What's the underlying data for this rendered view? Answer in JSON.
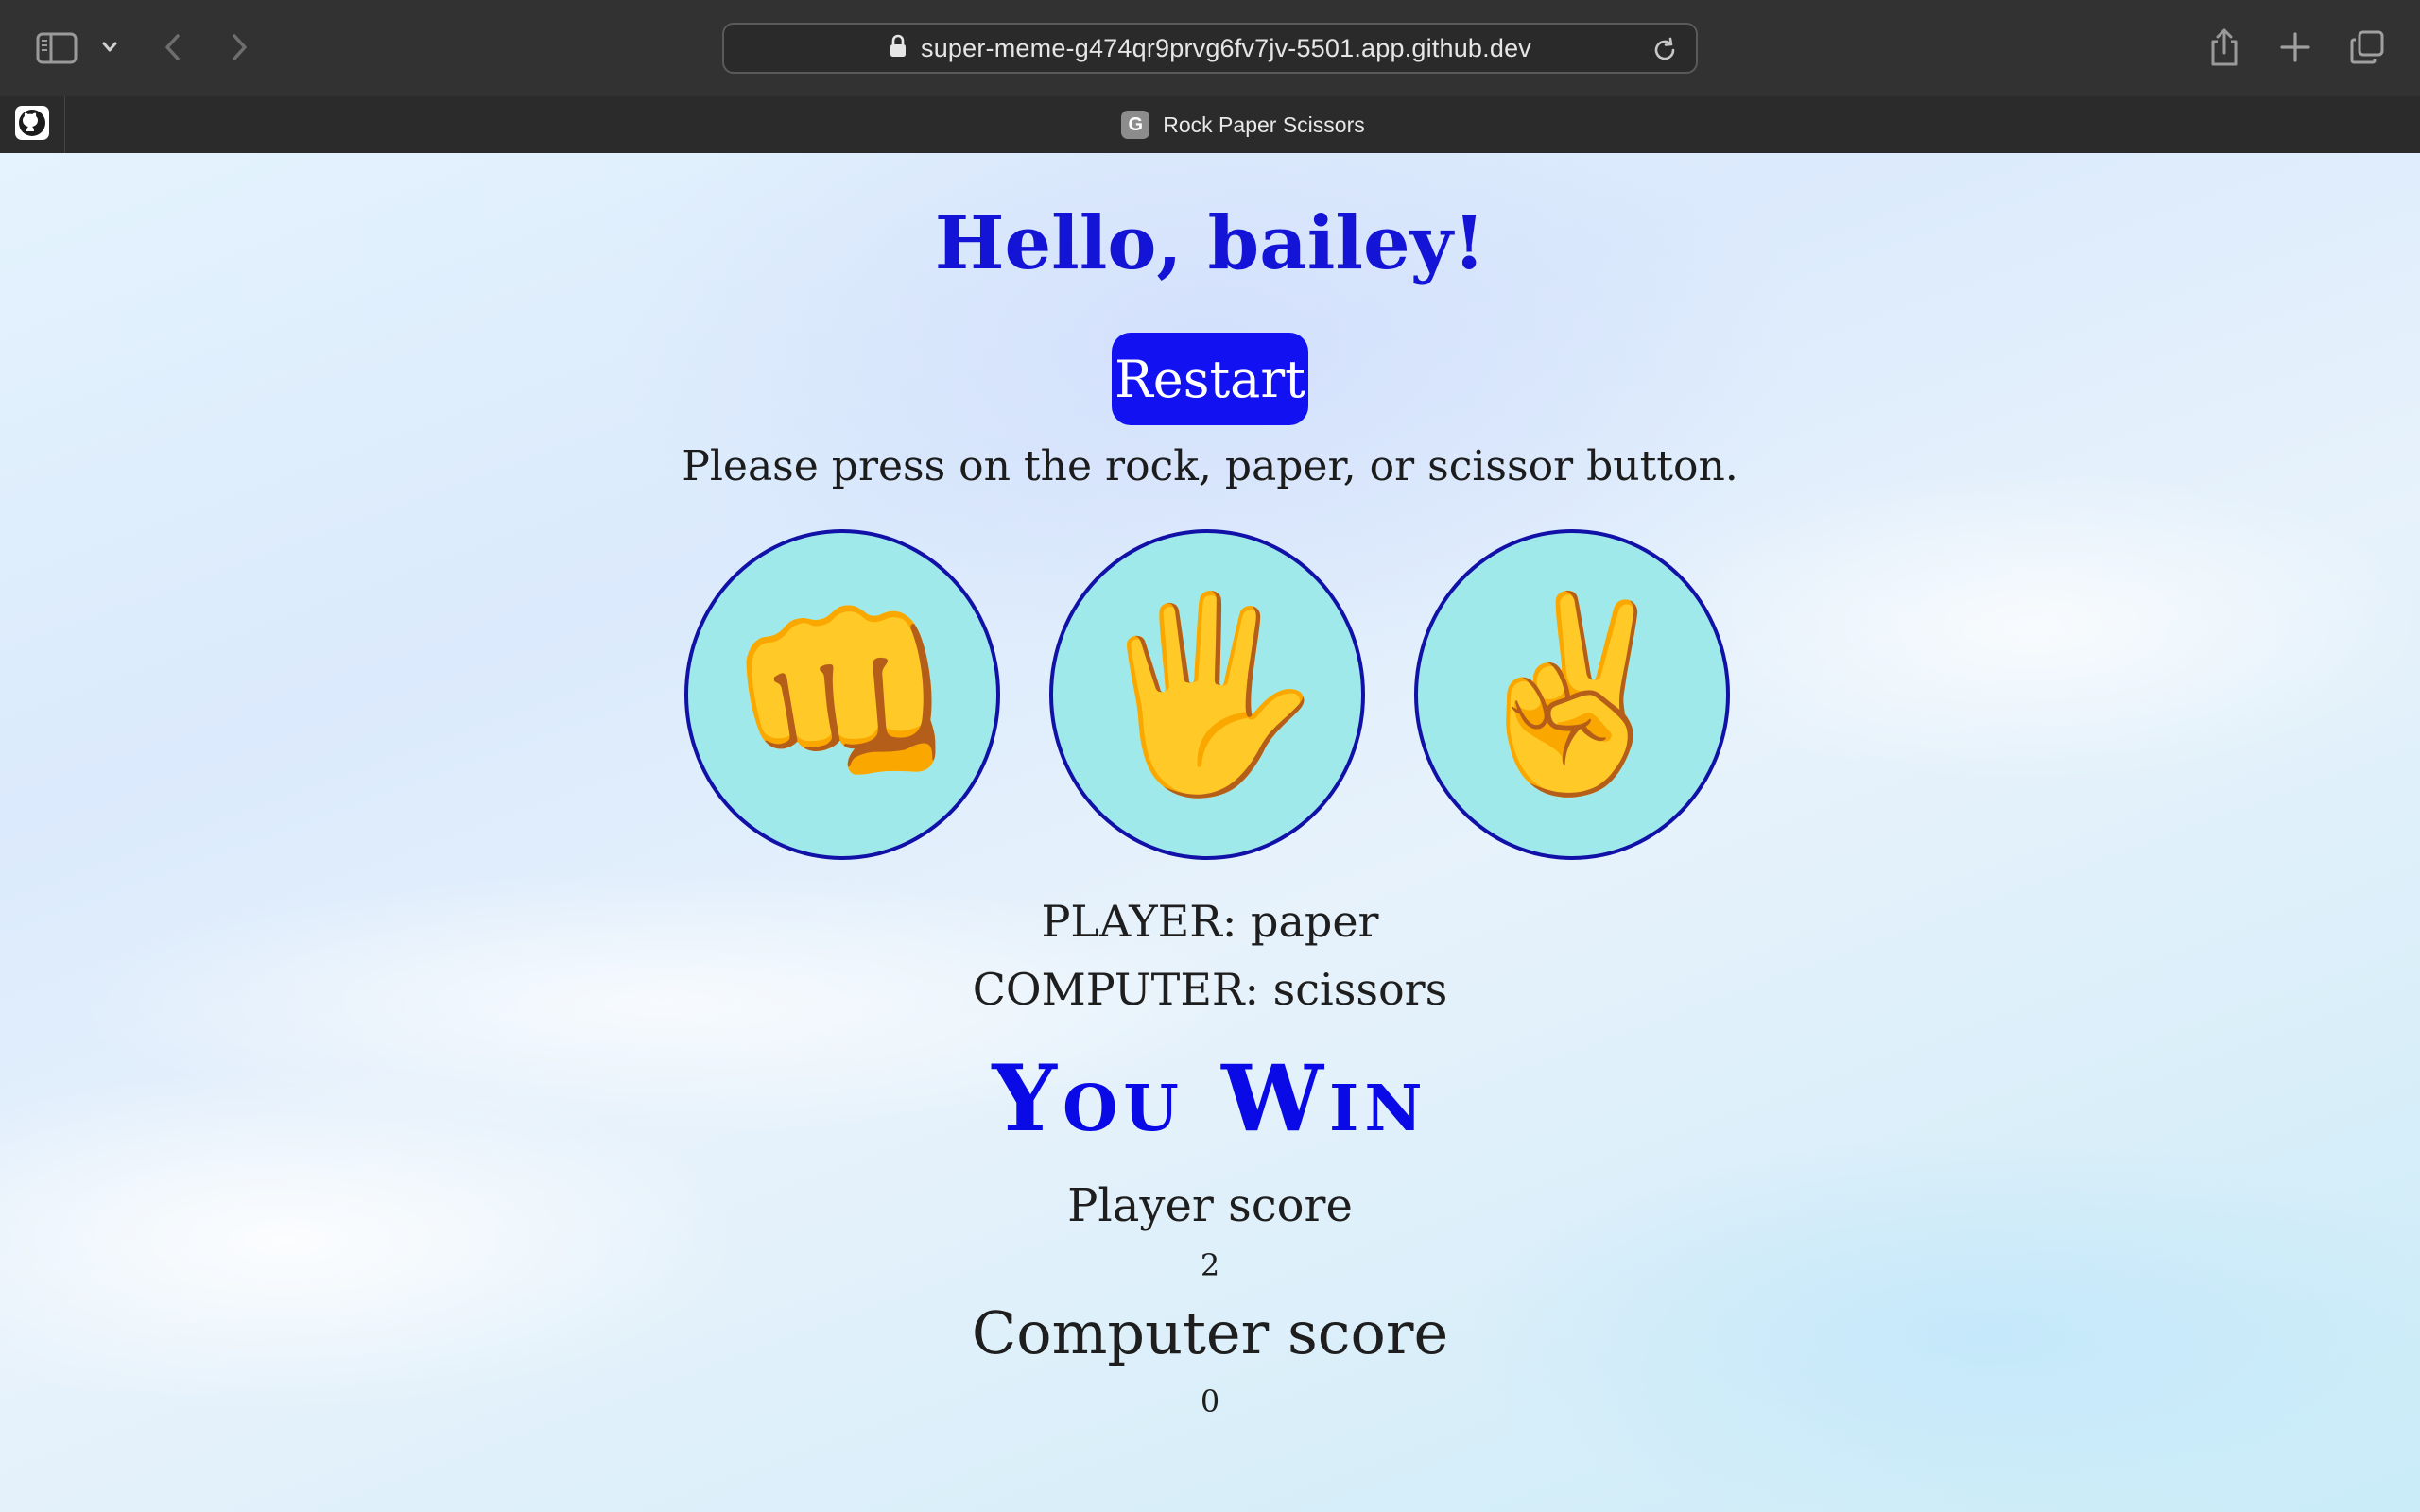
{
  "browser": {
    "url": "super-meme-g474qr9prvg6fv7jv-5501.app.github.dev",
    "tab_title": "Rock Paper Scissors",
    "favicon_letter": "G",
    "icons": [
      "sidebar-icon",
      "chevron-down-icon",
      "back-icon",
      "forward-icon",
      "lock-icon",
      "reload-icon",
      "share-icon",
      "new-tab-icon",
      "tab-overview-icon",
      "github-icon"
    ]
  },
  "game": {
    "greeting": "Hello, bailey!",
    "restart_label": "Restart",
    "instruction": "Please press on the rock, paper, or scissor button.",
    "choices": [
      {
        "name": "rock",
        "emoji": "👊"
      },
      {
        "name": "paper",
        "emoji": "🖐"
      },
      {
        "name": "scissors",
        "emoji": "✌️"
      }
    ],
    "player_line": "PLAYER: paper",
    "computer_line": "COMPUTER: scissors",
    "result": "You Win",
    "player_score_label": "Player score",
    "player_score": "2",
    "computer_score_label": "Computer score",
    "computer_score": "0"
  },
  "colors": {
    "heading": "#1414d6",
    "button": "#1111f2",
    "choice_fill": "#9fe9ea",
    "choice_border": "#1111a8",
    "result": "#0a0ae6"
  }
}
